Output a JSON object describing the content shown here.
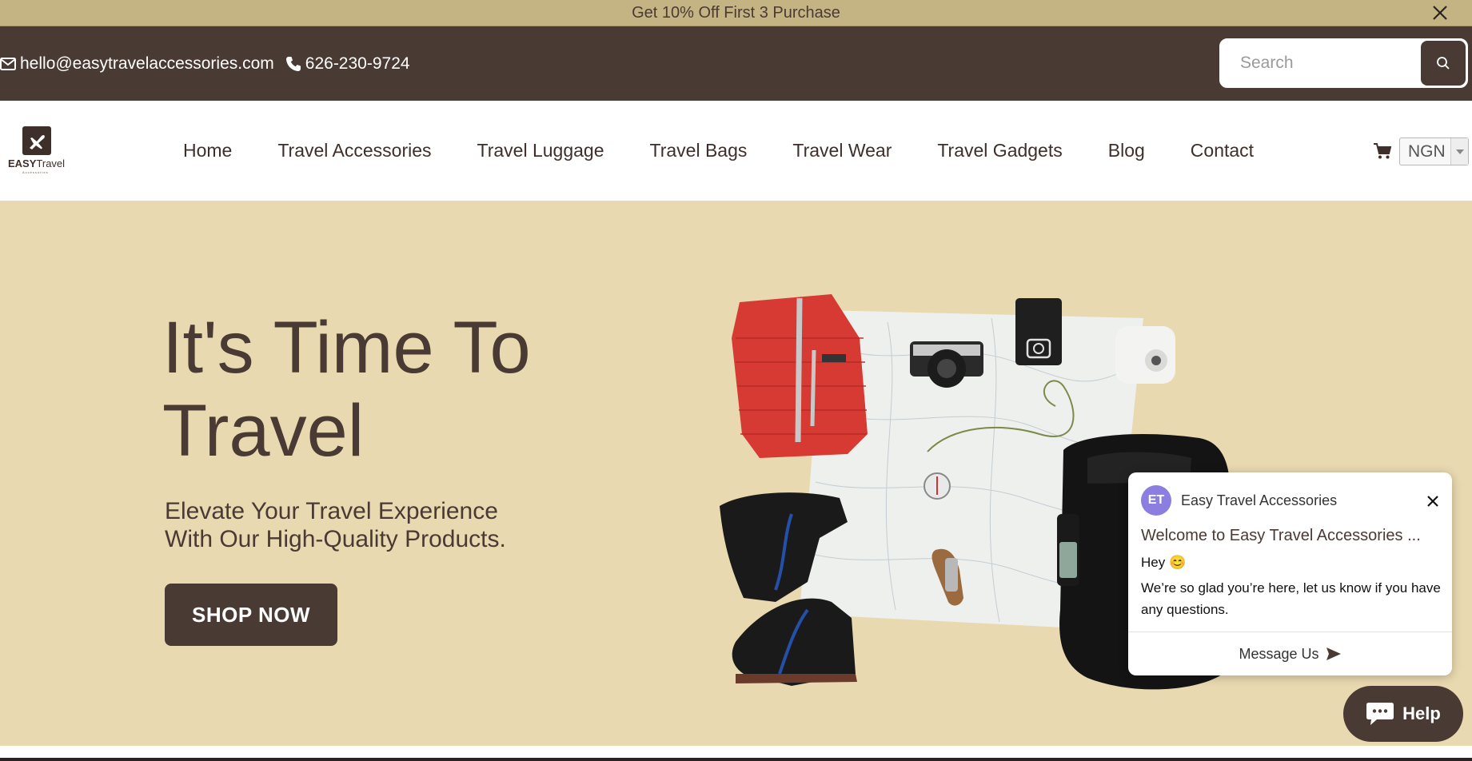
{
  "announcement": {
    "text": "Get 10% Off First 3 Purchase"
  },
  "topbar": {
    "email": "hello@easytravelaccessories.com",
    "phone": "626-230-9724",
    "search_placeholder": "Search"
  },
  "logo": {
    "word_bold": "EASY",
    "word_light": "Travel",
    "tagline": "Accessories"
  },
  "nav": {
    "items": [
      {
        "label": "Home"
      },
      {
        "label": "Travel Accessories"
      },
      {
        "label": "Travel Luggage"
      },
      {
        "label": "Travel Bags"
      },
      {
        "label": "Travel Wear"
      },
      {
        "label": "Travel Gadgets"
      },
      {
        "label": "Blog"
      },
      {
        "label": "Contact"
      }
    ],
    "currency": "NGN"
  },
  "hero": {
    "title_line1": "It's Time To",
    "title_line2": "Travel",
    "subtitle_line1": "Elevate Your Travel Experience",
    "subtitle_line2": "With Our High-Quality Products.",
    "cta": "SHOP NOW"
  },
  "chat": {
    "avatar_initials": "ET",
    "brand": "Easy Travel Accessories",
    "welcome": "Welcome to Easy Travel Accessories ...",
    "greeting": "Hey 😊",
    "message": "We’re so glad you’re here, let us know if you have any questions.",
    "action": "Message Us",
    "help_label": "Help"
  },
  "colors": {
    "brand_brown": "#4a3a34",
    "announce_bg": "#c5b483",
    "hero_bg": "#e9d9b0",
    "avatar": "#8b7ee0"
  }
}
